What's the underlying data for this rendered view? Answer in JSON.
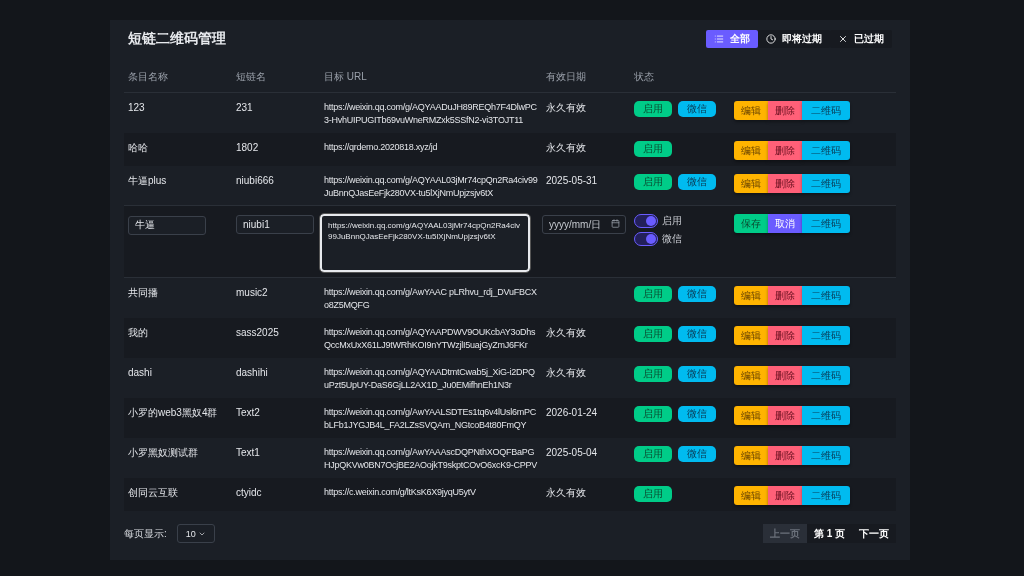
{
  "title": "短链二维码管理",
  "filters": [
    {
      "label": "全部",
      "selected": true
    },
    {
      "label": "即将过期",
      "selected": false
    },
    {
      "label": "已过期",
      "selected": false
    }
  ],
  "columns": [
    "条目名称",
    "短链名",
    "目标 URL",
    "有效日期",
    "状态"
  ],
  "rows": [
    {
      "kind": "view",
      "name": "123",
      "short": "231",
      "url": "https://weixin.qq.com/g/AQYAADuJH89REQh7F4DlwPC3-HvhUIPUGITb69vuWneRMZxk5SSfN2-vi3TOJT11",
      "date": "永久有效",
      "badges": [
        "启用",
        "微信"
      ],
      "actions": [
        "编辑",
        "删除",
        "二维码"
      ]
    },
    {
      "kind": "view",
      "name": "哈哈",
      "short": "1802",
      "url": "https://qrdemo.2020818.xyz/jd",
      "date": "永久有效",
      "badges": [
        "启用"
      ],
      "actions": [
        "编辑",
        "删除",
        "二维码"
      ]
    },
    {
      "kind": "view",
      "name": "牛逼plus",
      "short": "niubi666",
      "url": "https://weixin.qq.com/g/AQYAAL03jMr74cpQn2Ra4civ99JuBnnQJasEeFjk280VX-tu5lXjNmUpjzsjv6tX",
      "date": "2025-05-31",
      "badges": [
        "启用",
        "微信"
      ],
      "actions": [
        "编辑",
        "删除",
        "二维码"
      ]
    },
    {
      "kind": "edit",
      "name": "牛逼",
      "short": "niubi1",
      "url": "https://weixin.qq.com/g/AQYAAL03jMr74cpQn2Ra4civ99JuBnnQJasEeFjk280VX-tu5lXjNmUpjzsjv6tX",
      "date_placeholder": "yyyy/mm/日",
      "toggles": [
        {
          "label": "启用",
          "on": true
        },
        {
          "label": "微信",
          "on": true
        }
      ],
      "actions": [
        "保存",
        "取消",
        "二维码"
      ]
    },
    {
      "kind": "view",
      "name": "共同播",
      "short": "music2",
      "url": "https://weixin.qq.com/g/AwYAAC pLRhvu_rdj_DVuFBCXo8Z5MQFG",
      "badges": [
        "启用",
        "微信"
      ],
      "actions": [
        "编辑",
        "删除",
        "二维码"
      ]
    },
    {
      "kind": "view",
      "name": "我的",
      "short": "sass2025",
      "url": "https://weixin.qq.com/g/AQYAAPDWV9OUKcbAY3oDhsQccMxUxX61LJ9tWRhKOI9nYTWzjlI5uajGyZmJ6FKr",
      "date": "永久有效",
      "badges": [
        "启用",
        "微信"
      ],
      "actions": [
        "编辑",
        "删除",
        "二维码"
      ]
    },
    {
      "kind": "view",
      "name": "dashi",
      "short": "dashihi",
      "url": "https://weixin.qq.com/g/AQYAADtmtCwab5j_XiG-i2DPQuPzt5UpUY-DaS6GjLL2AX1D_Ju0EMifhnEh1N3r",
      "date": "永久有效",
      "badges": [
        "启用",
        "微信"
      ],
      "actions": [
        "编辑",
        "删除",
        "二维码"
      ]
    },
    {
      "kind": "view",
      "name": "小罗的web3黑奴4群",
      "short": "Text2",
      "url": "https://weixin.qq.com/g/AwYAALSDTEs1tq6v4lUsl6mPCbLFb1JYGJB4L_FA2LZsSVQAm_NGtcoB4t80FmQY",
      "date": "2026-01-24",
      "badges": [
        "启用",
        "微信"
      ],
      "actions": [
        "编辑",
        "删除",
        "二维码"
      ]
    },
    {
      "kind": "view",
      "name": "小罗黑奴测试群",
      "short": "Text1",
      "url": "https://weixin.qq.com/g/AwYAAAscDQPNthXOQFBaPGHJpQKVw0BN7OcjBE2AOojkT9skptCOvO6xcK9-CPPV",
      "date": "2025-05-04",
      "badges": [
        "启用",
        "微信"
      ],
      "actions": [
        "编辑",
        "删除",
        "二维码"
      ]
    },
    {
      "kind": "view",
      "name": "创同云互联",
      "short": "ctyidc",
      "url": "https://c.weixin.com/g/ltKsK6X9jyqU5ytV",
      "date": "永久有效",
      "badges": [
        "启用"
      ],
      "actions": [
        "编辑",
        "删除",
        "二维码"
      ]
    }
  ],
  "page_size": {
    "label": "每页显示:",
    "value": "10"
  },
  "pagination": [
    {
      "label": "上一页",
      "disabled": true
    },
    {
      "label": "第 1 页",
      "disabled": false
    },
    {
      "label": "下一页",
      "disabled": false
    }
  ]
}
